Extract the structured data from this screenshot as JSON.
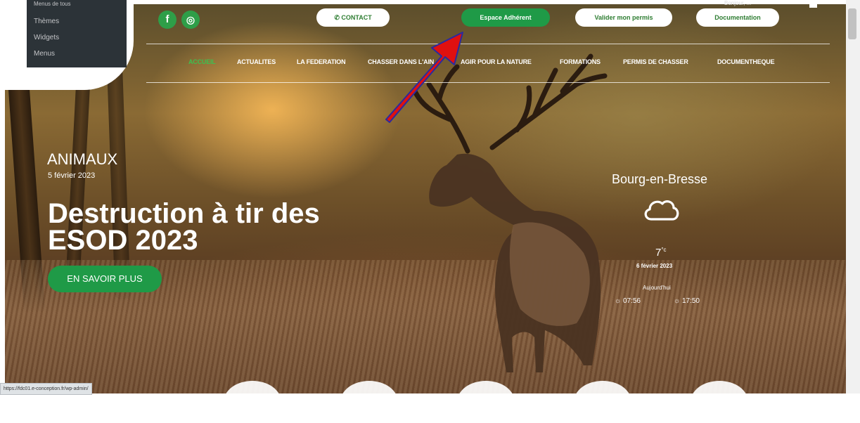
{
  "admin_menu": {
    "items": [
      "Menus de tous",
      "Thèmes",
      "Widgets",
      "Menus"
    ]
  },
  "header": {
    "social": {
      "facebook": "f",
      "instagram": "◎"
    },
    "contact_label": "CONTACT",
    "contact_icon": "phone-icon",
    "espace_label": "Espace Adhérent",
    "valider_label": "Valider mon permis",
    "documentation_label": "Documentation",
    "account_text": "Bonjour, ..."
  },
  "nav": {
    "items": [
      "ACCUEIL",
      "ACTUALITES",
      "LA FEDERATION",
      "CHASSER DANS L'AIN",
      "AGIR POUR LA NATURE",
      "FORMATIONS",
      "PERMIS DE CHASSER",
      "DOCUMENTHEQUE"
    ]
  },
  "hero": {
    "category": "ANIMAUX",
    "date": "5 février 2023",
    "headline_line1": "Destruction à tir des",
    "headline_line2": "ESOD 2023",
    "cta": "EN SAVOIR PLUS"
  },
  "weather": {
    "city": "Bourg-en-Bresse",
    "icon": "cloud-icon",
    "temp": "7",
    "unit": "°c",
    "date": "6 février 2023",
    "today": "Aujourd'hui",
    "sunrise": "07:56",
    "sunset": "17:50"
  },
  "status_url": "https://fdc01.e-conception.fr/wp-admin/",
  "colors": {
    "accent_green": "#1f9a47",
    "arrow_red": "#e01010"
  }
}
